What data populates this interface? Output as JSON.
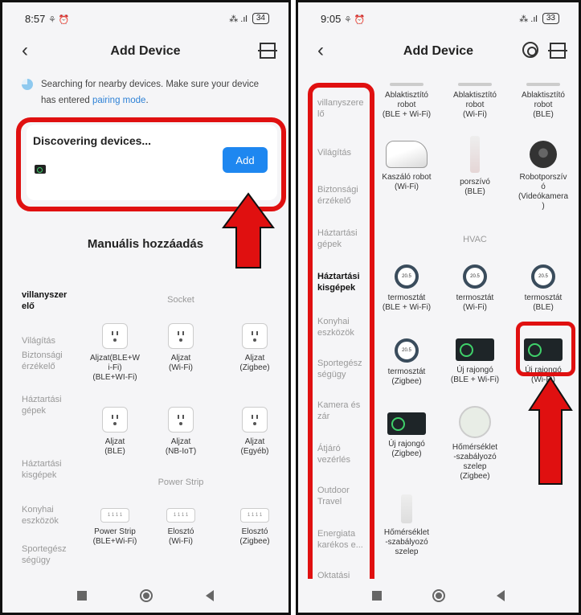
{
  "left": {
    "status": {
      "time": "8:57",
      "icons": "⚘ ⏰",
      "signal": "⁂ .ıl",
      "battery": "34"
    },
    "nav": {
      "title": "Add Device"
    },
    "search": {
      "text": "Searching for nearby devices. Make sure your device has entered",
      "link": "pairing mode",
      "suffix": "."
    },
    "discover": {
      "title": "Discovering devices...",
      "add_label": "Add"
    },
    "manual_title": "Manuális hozzáadás",
    "categories": [
      "villanyszer\nelő",
      "Világítás",
      "Biztonsági\nérzékelő",
      "Háztartási\ngépek",
      "Háztartási\nkisgépek",
      "Konyhai\neszközök",
      "Sportegész\nségügy"
    ],
    "sections": {
      "socket": "Socket",
      "power_strip": "Power Strip"
    },
    "tiles": [
      "Aljzat(BLE+W\ni-Fi)\n(BLE+WI-Fi)",
      "Aljzat\n(Wi-Fi)",
      "Aljzat\n(Zigbee)",
      "Aljzat\n(BLE)",
      "Aljzat\n(NB-IoT)",
      "Aljzat\n(Egyéb)",
      "Power Strip\n(BLE+Wi-Fi)",
      "Elosztó\n(Wi-Fi)",
      "Elosztó\n(Zigbee)"
    ],
    "strip_icon_text": "1 1 1 1"
  },
  "right": {
    "status": {
      "time": "9:05",
      "icons": "⚘ ⏰",
      "signal": "⁂ .ıl",
      "battery": "33"
    },
    "nav": {
      "title": "Add Device"
    },
    "categories": [
      "villanyszere\nlő",
      "Világítás",
      "Biztonsági\nérzékelő",
      "Háztartási\ngépek",
      "Háztartási\nkisgépek",
      "Konyhai\neszközök",
      "Sportegész\nségügy",
      "Kamera és\nzár",
      "Átjáró\nvezérlés",
      "Outdoor\nTravel",
      "Energiata\nkarékos e...",
      "Oktatási\nszórakozás"
    ],
    "section_hvac": "HVAC",
    "tiles": [
      "Ablaktisztító\nrobot\n(BLE + Wi-Fi)",
      "Ablaktisztító\nrobot\n(Wi-Fi)",
      "Ablaktisztító\nrobot\n(BLE)",
      "Kaszáló robot\n(Wi-Fi)",
      "porszívó\n(BLE)",
      "Robotporszív\nó\n(Videókamera\n)",
      "termosztát\n(BLE + Wi-Fi)",
      "termosztát\n(Wi-Fi)",
      "termosztát\n(BLE)",
      "termosztát\n(Zigbee)",
      "Új rajongó\n(BLE + Wi-Fi)",
      "Új rajongó\n(Wi-Fi)",
      "Új rajongó\n(Zigbee)",
      "Hőmérséklet\n-szabályozó\nszelep\n(Zigbee)",
      "Hőmérséklet\n-szabályozó\nszelep"
    ],
    "thermo_value": "20.5"
  }
}
